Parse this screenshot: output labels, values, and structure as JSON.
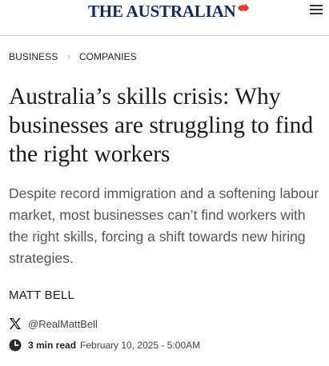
{
  "header": {
    "masthead": "THE AUSTRALIAN",
    "masthead_mark_color": "#e8412d",
    "menu_icon": "hamburger-menu-icon"
  },
  "breadcrumb": {
    "items": [
      "BUSINESS",
      "COMPANIES"
    ]
  },
  "article": {
    "headline": "Australia’s skills crisis: Why businesses are struggling to find the right workers",
    "standfirst": "Despite record immigration and a softening labour market, most businesses can’t find workers with the right skills, forcing a shift towards new hiring strategies.",
    "author": "MATT BELL",
    "twitter_handle": "@RealMattBell",
    "read_time": "3 min read",
    "published": "February 10, 2025 - 5:00AM"
  }
}
